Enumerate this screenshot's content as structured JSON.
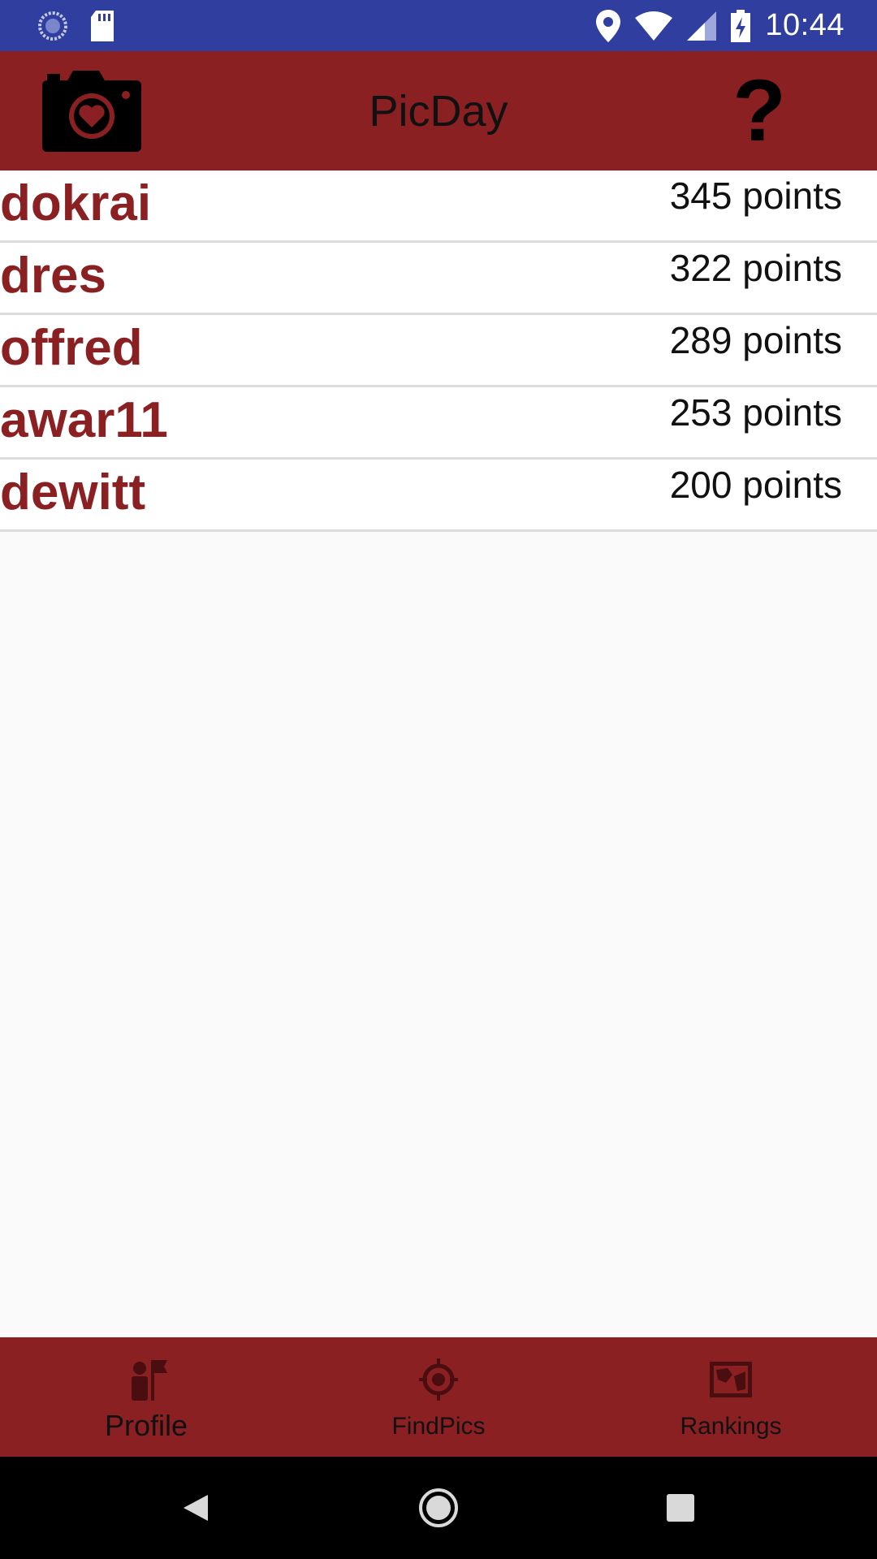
{
  "status_bar": {
    "time": "10:44",
    "left_icons": [
      "sync-icon",
      "sd-card-icon"
    ],
    "right_icons": [
      "location-icon",
      "wifi-icon",
      "signal-icon",
      "battery-charging-icon"
    ],
    "background_color": "#303f9f"
  },
  "app_bar": {
    "title": "PicDay",
    "left_icon": "camera-heart-icon",
    "right_icon": "help-icon",
    "help_symbol": "?",
    "background_color": "#8b2022"
  },
  "rankings": [
    {
      "name": "dokrai",
      "points": "345 points"
    },
    {
      "name": "dres",
      "points": "322 points"
    },
    {
      "name": "offred",
      "points": "289 points"
    },
    {
      "name": "awar11",
      "points": "253 points"
    },
    {
      "name": "dewitt",
      "points": "200 points"
    }
  ],
  "bottom_nav": {
    "items": [
      {
        "label": "Profile",
        "icon": "person-flag-icon"
      },
      {
        "label": "FindPics",
        "icon": "crosshair-icon"
      },
      {
        "label": "Rankings",
        "icon": "map-icon"
      }
    ]
  },
  "system_nav": {
    "icons": [
      "back-icon",
      "home-icon",
      "recents-icon"
    ]
  },
  "colors": {
    "accent": "#8b2022",
    "list_divider": "#dcdcdc",
    "page_background": "#fafafa"
  }
}
